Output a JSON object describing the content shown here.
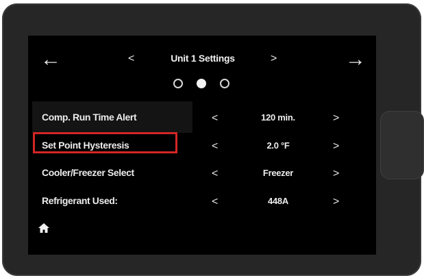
{
  "header": {
    "back_arrow": "←",
    "forward_arrow": "→",
    "prev_chevron": "<",
    "next_chevron": ">",
    "title": "Unit 1 Settings"
  },
  "pagination": {
    "pages": 3,
    "active_page": 2
  },
  "settings": [
    {
      "label": "Comp. Run Time Alert",
      "value": "120 min.",
      "prev": "<",
      "next": ">"
    },
    {
      "label": "Set Point Hysteresis",
      "value": "2.0 °F",
      "prev": "<",
      "next": ">",
      "highlighted": true
    },
    {
      "label": "Cooler/Freezer Select",
      "value": "Freezer",
      "prev": "<",
      "next": ">"
    },
    {
      "label": "Refrigerant Used:",
      "value": "448A",
      "prev": "<",
      "next": ">"
    }
  ],
  "footer": {
    "home_icon": "home-icon"
  },
  "colors": {
    "highlight": "#d32626",
    "screen_bg": "#000000",
    "bezel": "#262626",
    "text": "#ececec"
  }
}
